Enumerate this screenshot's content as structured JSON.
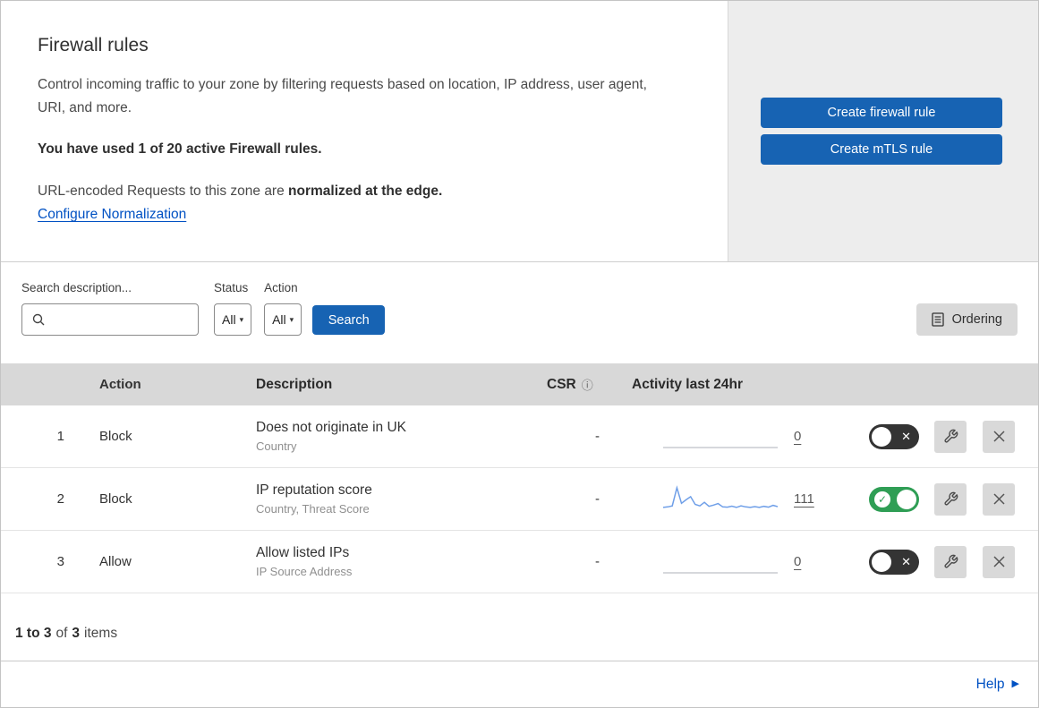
{
  "colors": {
    "primary_blue": "#1763b3",
    "link_blue": "#0051c3",
    "toggle_green": "#2f9e55",
    "toggle_off_dark": "#343434",
    "table_header_gray": "#d8d8d8",
    "panel_gray": "#ededed"
  },
  "icons": {
    "caret_down": "▾",
    "info": "ⓘ",
    "toggle_off": "✕",
    "toggle_on": "✓",
    "help_arrow": "▶"
  },
  "header": {
    "title": "Firewall rules",
    "description": "Control incoming traffic to your zone by filtering requests based on location, IP address, user agent, URI, and more.",
    "usage": "You have used 1 of 20 active Firewall rules.",
    "normalization_text": "URL-encoded Requests to this zone are",
    "normalization_bold": "normalized at the edge.",
    "normalization_link": "Configure Normalization",
    "create_firewall_label": "Create firewall rule",
    "create_mtls_label": "Create mTLS rule"
  },
  "filters": {
    "search_label": "Search description...",
    "search_value": "",
    "status_label": "Status",
    "status_value": "All",
    "action_label": "Action",
    "action_value": "All",
    "search_button": "Search",
    "ordering_button": "Ordering"
  },
  "table": {
    "headers": {
      "action": "Action",
      "description": "Description",
      "csr": "CSR",
      "activity": "Activity last 24hr"
    },
    "rows": [
      {
        "num": "1",
        "action": "Block",
        "title": "Does not originate in UK",
        "subtitle": "Country",
        "csr": "-",
        "count": "0",
        "enabled": false,
        "spark_color": "#c9ccd1",
        "sparkline": [
          0,
          0,
          0,
          0,
          0,
          0,
          0,
          0,
          0,
          0,
          0,
          0,
          0,
          0,
          0,
          0,
          0,
          0,
          0,
          0,
          0,
          0,
          0,
          0,
          0,
          0
        ]
      },
      {
        "num": "2",
        "action": "Block",
        "title": "IP reputation score",
        "subtitle": "Country, Threat Score",
        "csr": "-",
        "count": "111",
        "enabled": true,
        "spark_color": "#6f9fe8",
        "sparkline": [
          1.8,
          2.0,
          2.4,
          9.5,
          3.4,
          4.8,
          6.0,
          3.0,
          2.4,
          3.8,
          2.2,
          2.7,
          3.3,
          2.0,
          1.9,
          2.3,
          1.8,
          2.4,
          2.0,
          1.8,
          2.1,
          1.8,
          2.2,
          1.9,
          2.6,
          2.1
        ]
      },
      {
        "num": "3",
        "action": "Allow",
        "title": "Allow listed IPs",
        "subtitle": "IP Source Address",
        "csr": "-",
        "count": "0",
        "enabled": false,
        "spark_color": "#c9ccd1",
        "sparkline": [
          0,
          0,
          0,
          0,
          0,
          0,
          0,
          0,
          0,
          0,
          0,
          0,
          0,
          0,
          0,
          0,
          0,
          0,
          0,
          0,
          0,
          0,
          0,
          0,
          0,
          0
        ]
      }
    ],
    "footer": {
      "range": "1 to 3",
      "of": "of",
      "total": "3",
      "items": "items"
    }
  },
  "help": {
    "label": "Help"
  }
}
